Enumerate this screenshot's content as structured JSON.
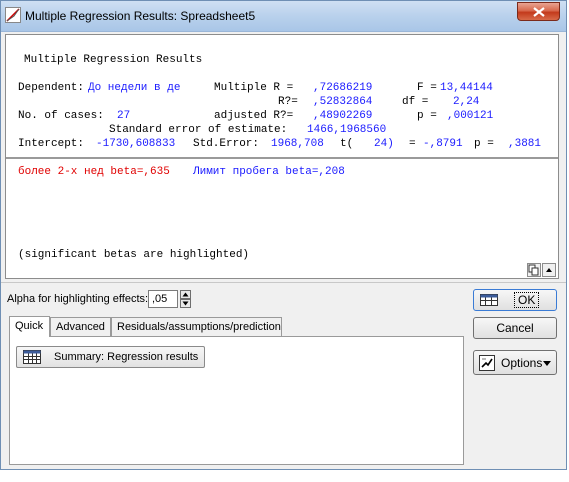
{
  "window": {
    "title": "Multiple Regression Results: Spreadsheet5"
  },
  "results": {
    "heading": "Multiple Regression Results",
    "dependent_label": "Dependent:",
    "dependent_value": "До недели в де",
    "multiple_r_label": "Multiple R =",
    "multiple_r_value": ",72686219",
    "f_label": "F =",
    "f_value": "13,44144",
    "r2_label": "R?=",
    "r2_value": ",52832864",
    "df_label": "df =",
    "df_value": "2,24",
    "cases_label": "No. of cases:",
    "cases_value": "27",
    "adj_r2_label": "adjusted R?=",
    "adj_r2_value": ",48902269",
    "p_label": "p =",
    "p_value": ",000121",
    "se_estimate_label": "Standard error of estimate:",
    "se_estimate_value": "1466,1968560",
    "intercept_label": "Intercept:",
    "intercept_value": "-1730,608833",
    "std_error_label": "Std.Error:",
    "std_error_value": "1968,708",
    "t_label": "t(",
    "t_df": "24)",
    "t_eq": "=",
    "t_value": "-,8791",
    "p2_label": "p =",
    "p2_value": ",3881",
    "beta_red": "более 2-х нед beta=,635",
    "beta_blue": "Лимит пробега beta=,208",
    "note": "(significant betas are highlighted)"
  },
  "controls": {
    "alpha_label": "Alpha for highlighting effects:",
    "alpha_value": ",05",
    "tabs": [
      {
        "label": "Quick"
      },
      {
        "label": "Advanced"
      },
      {
        "label": "Residuals/assumptions/prediction"
      }
    ],
    "summary_button": "Summary:  Regression results",
    "ok_button": "OK",
    "cancel_button": "Cancel",
    "options_button": "Options"
  },
  "colors": {
    "value_blue": "#1a1aff",
    "highlight_red": "#e00000",
    "titlebar": "#b9d1ec"
  }
}
